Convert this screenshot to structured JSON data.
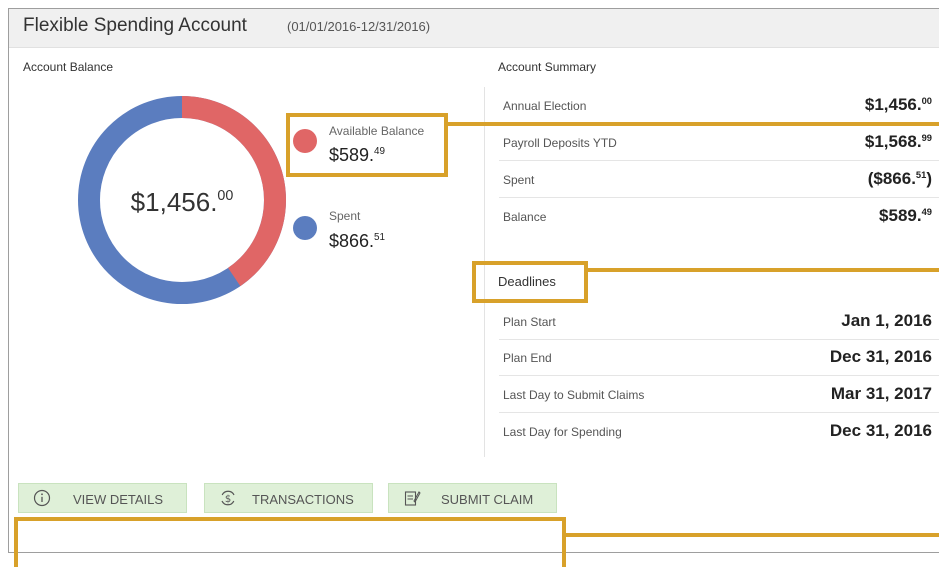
{
  "header": {
    "title": "Flexible Spending Account",
    "period": "(01/01/2016-12/31/2016)"
  },
  "balance": {
    "label": "Account Balance",
    "total_main": "$1,456.",
    "total_cents": "00",
    "chart": {
      "available_fraction": 0.405,
      "spent_fraction": 0.595,
      "colors": {
        "available": "#e06666",
        "spent": "#5b7dbf"
      }
    },
    "legend": [
      {
        "label": "Available Balance",
        "amount": "$589.",
        "cents": "49",
        "color": "#e06666"
      },
      {
        "label": "Spent",
        "amount": "$866.",
        "cents": "51",
        "color": "#5b7dbf"
      }
    ]
  },
  "summary": {
    "label": "Account Summary",
    "rows": [
      {
        "label": "Annual Election",
        "value": "$1,456.",
        "cents": "00",
        "suffix": ""
      },
      {
        "label": "Payroll Deposits YTD",
        "value": "$1,568.",
        "cents": "99",
        "suffix": ""
      },
      {
        "label": "Spent",
        "value": "($866.",
        "cents": "51",
        "suffix": ")"
      },
      {
        "label": "Balance",
        "value": "$589.",
        "cents": "49",
        "suffix": ""
      }
    ]
  },
  "deadlines": {
    "label": "Deadlines",
    "rows": [
      {
        "label": "Plan Start",
        "value": "Jan 1, 2016"
      },
      {
        "label": "Plan End",
        "value": "Dec 31, 2016"
      },
      {
        "label": "Last Day to Submit Claims",
        "value": "Mar 31, 2017"
      },
      {
        "label": "Last Day for Spending",
        "value": "Dec 31, 2016"
      }
    ]
  },
  "actions": {
    "view_details": "VIEW DETAILS",
    "transactions": "TRANSACTIONS",
    "submit_claim": "SUBMIT CLAIM"
  },
  "colors": {
    "highlight": "#d8a12a",
    "button_bg": "#dff0d8"
  }
}
